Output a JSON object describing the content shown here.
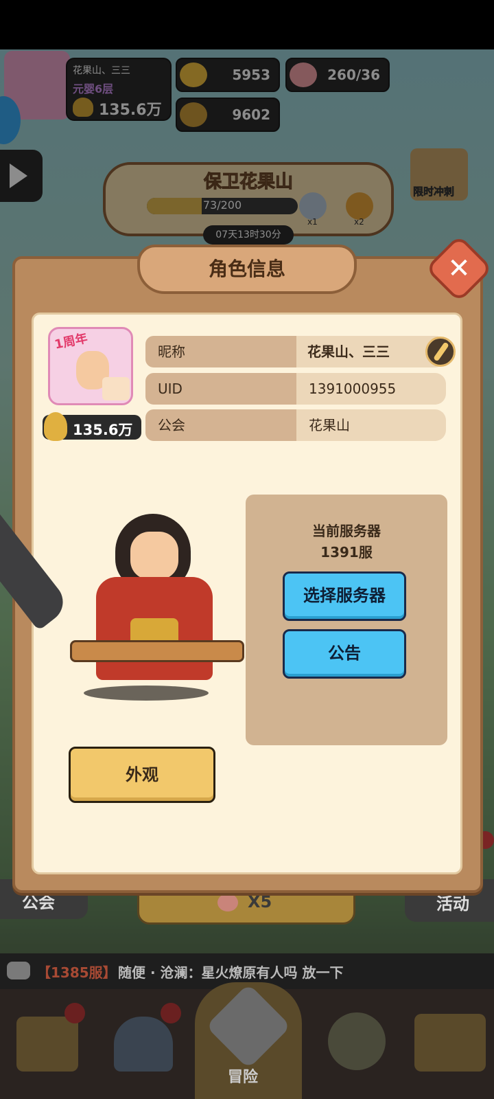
{
  "player": {
    "name": "花果山、三三",
    "stage": "元婴6层",
    "power": "135.6万"
  },
  "resources": {
    "gold": "5953",
    "peach": "260/36",
    "coin": "9602"
  },
  "event": {
    "title": "保卫花果山",
    "progress": "73/200",
    "progress_fraction": 0.365,
    "timer": "07天13时30分",
    "reward1_count": "x1",
    "reward2_count": "x2"
  },
  "side": {
    "limited_sprint": "限时冲刺"
  },
  "modal": {
    "title": "角色信息",
    "badge": "1周年",
    "power": "135.6万",
    "fields": [
      {
        "label": "昵称",
        "value": "花果山、三三"
      },
      {
        "label": "UID",
        "value": "1391000955"
      },
      {
        "label": "公会",
        "value": "花果山"
      }
    ],
    "server_label": "当前服务器",
    "server_value": "1391服",
    "select_server": "选择服务器",
    "announcement": "公告",
    "appearance": "外观"
  },
  "bottom": {
    "guild": "公会",
    "peach_mult": "X5",
    "activity": "活动",
    "adventure": "冒险"
  },
  "chat": {
    "server_tag": "【1385服】",
    "message": "随便 · 沧澜：星火燎原有人吗 放一下"
  },
  "colors": {
    "accent_blue": "#4cc4f4",
    "button_gold": "#f2c86b",
    "panel_brown": "#b98a5e",
    "alert_red": "#e23a3a",
    "chat_server": "#e26b4e"
  },
  "icons": [
    "play-icon",
    "gold-ingot-icon",
    "peach-icon",
    "coin-icon",
    "brush-icon",
    "close-icon",
    "chat-icon",
    "chest-icon",
    "helmet-icon",
    "crossed-swords-icon",
    "upgrade-icon",
    "treasure-chest-icon"
  ]
}
